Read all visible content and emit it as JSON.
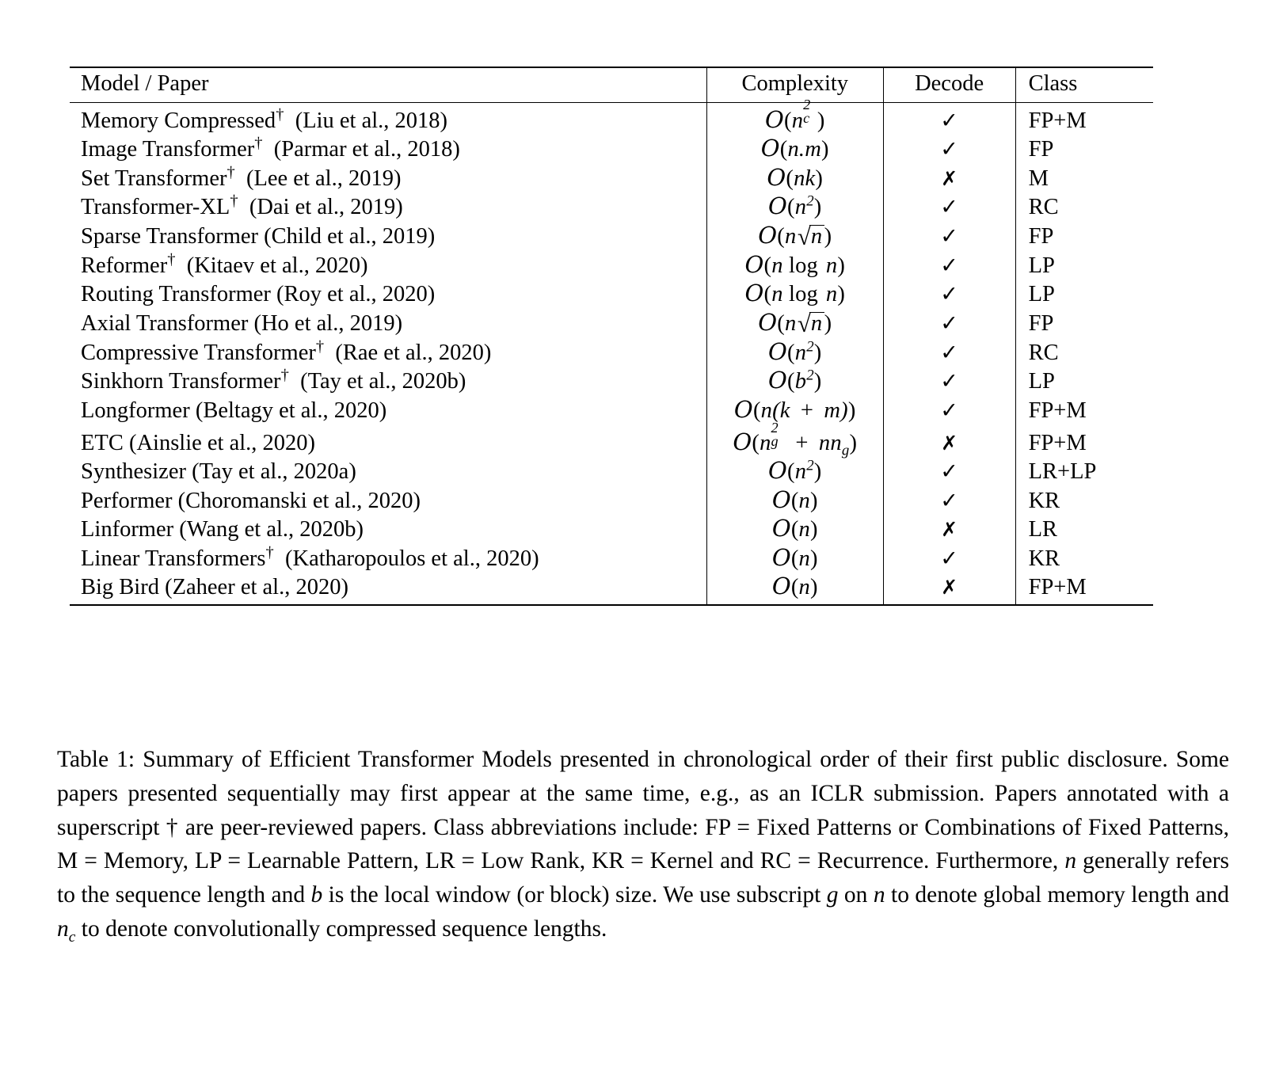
{
  "table": {
    "columns": [
      "Model / Paper",
      "Complexity",
      "Decode",
      "Class"
    ],
    "rows": [
      {
        "model_name": "Memory Compressed",
        "dagger": true,
        "citation": "(Liu et al., 2018)",
        "complexity_text": "O(n_c^2)",
        "decode": "✓",
        "decode_value": true,
        "class": "FP+M"
      },
      {
        "model_name": "Image Transformer",
        "dagger": true,
        "citation": "(Parmar et al., 2018)",
        "complexity_text": "O(n.m)",
        "decode": "✓",
        "decode_value": true,
        "class": "FP"
      },
      {
        "model_name": "Set Transformer",
        "dagger": true,
        "citation": "(Lee et al., 2019)",
        "complexity_text": "O(nk)",
        "decode": "✗",
        "decode_value": false,
        "class": "M"
      },
      {
        "model_name": "Transformer-XL",
        "dagger": true,
        "citation": "(Dai et al., 2019)",
        "complexity_text": "O(n^2)",
        "decode": "✓",
        "decode_value": true,
        "class": "RC"
      },
      {
        "model_name": "Sparse Transformer",
        "dagger": false,
        "citation": "(Child et al., 2019)",
        "complexity_text": "O(n√n)",
        "decode": "✓",
        "decode_value": true,
        "class": "FP"
      },
      {
        "model_name": "Reformer",
        "dagger": true,
        "citation": "(Kitaev et al., 2020)",
        "complexity_text": "O(n log n)",
        "decode": "✓",
        "decode_value": true,
        "class": "LP"
      },
      {
        "model_name": "Routing Transformer",
        "dagger": false,
        "citation": "(Roy et al., 2020)",
        "complexity_text": "O(n log n)",
        "decode": "✓",
        "decode_value": true,
        "class": "LP"
      },
      {
        "model_name": "Axial Transformer",
        "dagger": false,
        "citation": "(Ho et al., 2019)",
        "complexity_text": "O(n√n)",
        "decode": "✓",
        "decode_value": true,
        "class": "FP"
      },
      {
        "model_name": "Compressive Transformer",
        "dagger": true,
        "citation": "(Rae et al., 2020)",
        "complexity_text": "O(n^2)",
        "decode": "✓",
        "decode_value": true,
        "class": "RC"
      },
      {
        "model_name": "Sinkhorn Transformer",
        "dagger": true,
        "citation": "(Tay et al., 2020b)",
        "complexity_text": "O(b^2)",
        "decode": "✓",
        "decode_value": true,
        "class": "LP"
      },
      {
        "model_name": "Longformer",
        "dagger": false,
        "citation": "(Beltagy et al., 2020)",
        "complexity_text": "O(n(k + m))",
        "decode": "✓",
        "decode_value": true,
        "class": "FP+M"
      },
      {
        "model_name": "ETC",
        "dagger": false,
        "citation": "(Ainslie et al., 2020)",
        "complexity_text": "O(n_g^2 + nn_g)",
        "decode": "✗",
        "decode_value": false,
        "class": "FP+M"
      },
      {
        "model_name": "Synthesizer",
        "dagger": false,
        "citation": "(Tay et al., 2020a)",
        "complexity_text": "O(n^2)",
        "decode": "✓",
        "decode_value": true,
        "class": "LR+LP"
      },
      {
        "model_name": "Performer",
        "dagger": false,
        "citation": "(Choromanski et al., 2020)",
        "complexity_text": "O(n)",
        "decode": "✓",
        "decode_value": true,
        "class": "KR"
      },
      {
        "model_name": "Linformer",
        "dagger": false,
        "citation": "(Wang et al., 2020b)",
        "complexity_text": "O(n)",
        "decode": "✗",
        "decode_value": false,
        "class": "LR"
      },
      {
        "model_name": "Linear Transformers",
        "dagger": true,
        "citation": "(Katharopoulos et al., 2020)",
        "complexity_text": "O(n)",
        "decode": "✓",
        "decode_value": true,
        "class": "KR"
      },
      {
        "model_name": "Big Bird",
        "dagger": false,
        "citation": "(Zaheer et al., 2020)",
        "complexity_text": "O(n)",
        "decode": "✗",
        "decode_value": false,
        "class": "FP+M"
      }
    ]
  },
  "caption": {
    "label": "Table 1:",
    "part1": " Summary of Efficient Transformer Models presented in chronological order of their first public disclosure. Some papers presented sequentially may first appear at the same time, e.g., as an ICLR submission. Papers annotated with a superscript † are peer-reviewed papers. Class abbreviations include: FP = Fixed Patterns or Combinations of Fixed Patterns, M = Memory, LP = Learnable Pattern, LR = Low Rank, KR = Kernel and RC = Recurrence. Furthermore, ",
    "math_n_1": "n",
    "part2": " generally refers to the sequence length and ",
    "math_b": "b",
    "part3": " is the local window (or block) size. We use subscript ",
    "math_g": "g",
    "part4": " on ",
    "math_n_2": "n",
    "part5": " to denote global memory length and ",
    "math_nc": "n",
    "math_nc_sub": "c",
    "part6": " to denote convolutionally compressed sequence lengths."
  }
}
